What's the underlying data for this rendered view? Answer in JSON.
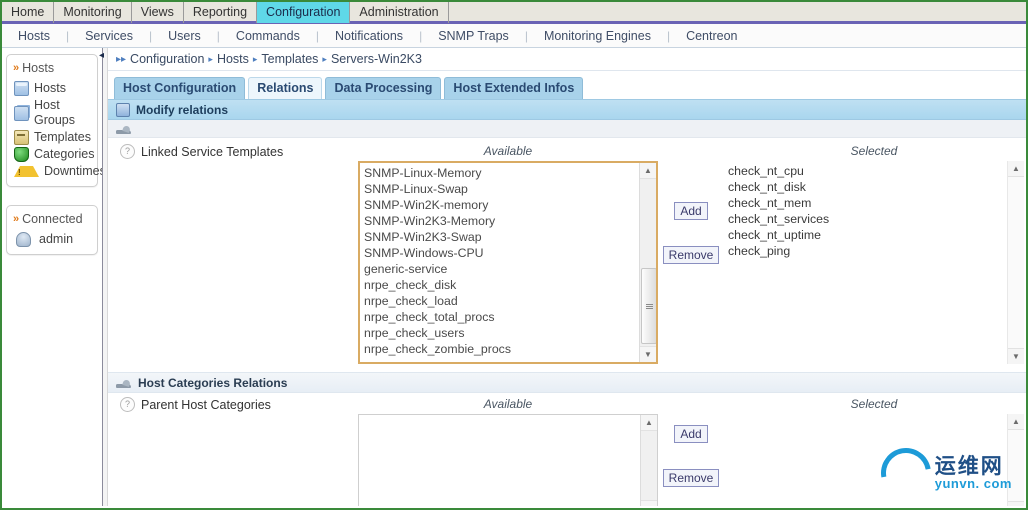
{
  "topmenu": {
    "items": [
      {
        "label": "Home",
        "active": false
      },
      {
        "label": "Monitoring",
        "active": false
      },
      {
        "label": "Views",
        "active": false
      },
      {
        "label": "Reporting",
        "active": false
      },
      {
        "label": "Configuration",
        "active": true
      },
      {
        "label": "Administration",
        "active": false
      }
    ]
  },
  "submenu": {
    "items": [
      "Hosts",
      "Services",
      "Users",
      "Commands",
      "Notifications",
      "SNMP Traps",
      "Monitoring Engines",
      "Centreon"
    ]
  },
  "sidebar": {
    "hosts_panel": {
      "title": "Hosts",
      "items": [
        {
          "label": "Hosts",
          "icon": "database-icon"
        },
        {
          "label": "Host Groups",
          "icon": "database-stack-icon"
        },
        {
          "label": "Templates",
          "icon": "template-icon"
        },
        {
          "label": "Categories",
          "icon": "category-icon"
        },
        {
          "label": "Downtimes",
          "icon": "warning-icon"
        }
      ]
    },
    "connected_panel": {
      "title": "Connected",
      "items": [
        {
          "label": "admin",
          "icon": "user-icon"
        }
      ]
    }
  },
  "breadcrumb": {
    "items": [
      "Configuration",
      "Hosts",
      "Templates",
      "Servers-Win2K3"
    ]
  },
  "tabs": [
    {
      "label": "Host Configuration",
      "active": false
    },
    {
      "label": "Relations",
      "active": true
    },
    {
      "label": "Data Processing",
      "active": false
    },
    {
      "label": "Host Extended Infos",
      "active": false
    }
  ],
  "page_header": {
    "title": "Modify relations",
    "icon": "list-icon"
  },
  "sections": [
    {
      "header": "",
      "field_label": "Linked Service Templates",
      "available_caption": "Available",
      "selected_caption": "Selected",
      "add_label": "Add",
      "remove_label": "Remove",
      "available": [
        "SNMP-Linux-Memory",
        "SNMP-Linux-Swap",
        "SNMP-Win2K-memory",
        "SNMP-Win2K3-Memory",
        "SNMP-Win2K3-Swap",
        "SNMP-Windows-CPU",
        "generic-service",
        "nrpe_check_disk",
        "nrpe_check_load",
        "nrpe_check_total_procs",
        "nrpe_check_users",
        "nrpe_check_zombie_procs"
      ],
      "selected": [
        "check_nt_cpu",
        "check_nt_disk",
        "check_nt_mem",
        "check_nt_services",
        "check_nt_uptime",
        "check_ping"
      ]
    },
    {
      "header": "Host Categories Relations",
      "field_label": "Parent Host Categories",
      "available_caption": "Available",
      "selected_caption": "Selected",
      "add_label": "Add",
      "remove_label": "Remove",
      "available": [],
      "selected": []
    }
  ],
  "watermark": {
    "cn": "运维网",
    "en": "yunvn. com"
  },
  "colors": {
    "accent_tab": "#a8d2ea",
    "active_menu": "#5fd8e8",
    "page_border": "#3a8a3a",
    "menu_rule": "#6a63b5",
    "focus_border": "#d9ab63"
  }
}
